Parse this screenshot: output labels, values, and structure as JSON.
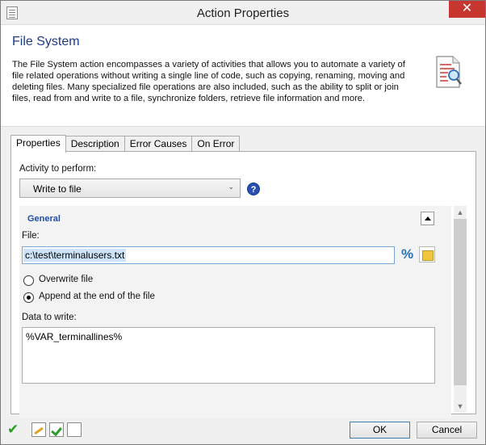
{
  "window": {
    "title": "Action Properties",
    "close_label": "✕"
  },
  "header": {
    "title": "File System",
    "description": "The File System action encompasses a variety of activities that allows you to automate a variety of file related operations without writing a single line of code, such as copying, renaming, moving and deleting files. Many specialized file operations are also included, such as the ability to split or join files, read from and write to a file, synchronize folders, retrieve file information and more."
  },
  "tabs": [
    {
      "label": "Properties",
      "active": true
    },
    {
      "label": "Description",
      "active": false
    },
    {
      "label": "Error Causes",
      "active": false
    },
    {
      "label": "On Error",
      "active": false
    }
  ],
  "properties": {
    "activity_label": "Activity to perform:",
    "activity_value": "Write to file",
    "group_title": "General",
    "file_label": "File:",
    "file_value": "c:\\test\\terminalusers.txt",
    "radio_overwrite": "Overwrite file",
    "radio_append": "Append at the end of the file",
    "selected_radio": "append",
    "data_label": "Data to write:",
    "data_value": "%VAR_terminallines%"
  },
  "footer": {
    "ok_label": "OK",
    "cancel_label": "Cancel"
  },
  "icons": {
    "help": "help-icon",
    "variable": "percent-icon",
    "browse": "folder-icon"
  },
  "colors": {
    "header_title": "#1e3a8a",
    "group_title": "#1e4ea8",
    "close_button": "#c7372f"
  }
}
